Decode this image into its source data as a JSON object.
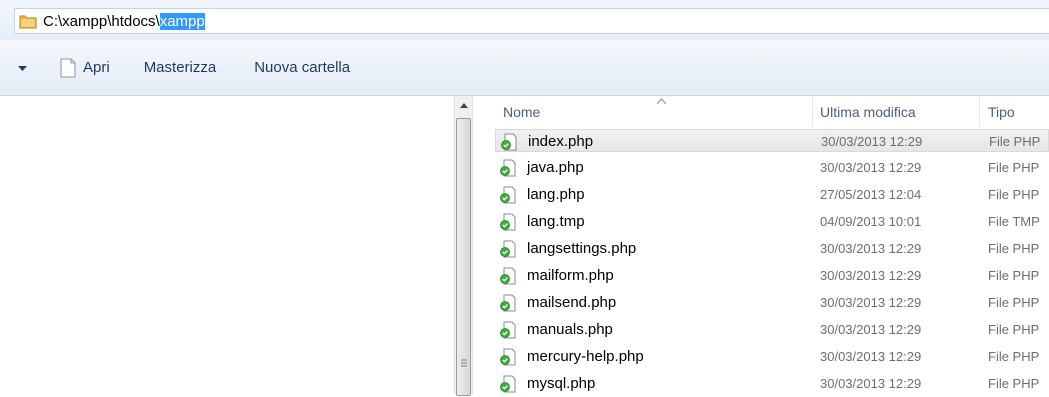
{
  "address": {
    "path_prefix": "C:\\xampp\\htdocs\\",
    "path_selected": "xampp"
  },
  "toolbar": {
    "open_label": "Apri",
    "burn_label": "Masterizza",
    "new_folder_label": "Nuova cartella"
  },
  "columns": {
    "name": "Nome",
    "modified": "Ultima modifica",
    "type": "Tipo"
  },
  "files": [
    {
      "name": "index.php",
      "modified": "30/03/2013 12:29",
      "type": "File PHP"
    },
    {
      "name": "java.php",
      "modified": "30/03/2013 12:29",
      "type": "File PHP"
    },
    {
      "name": "lang.php",
      "modified": "27/05/2013 12:04",
      "type": "File PHP"
    },
    {
      "name": "lang.tmp",
      "modified": "04/09/2013 10:01",
      "type": "File TMP"
    },
    {
      "name": "langsettings.php",
      "modified": "30/03/2013 12:29",
      "type": "File PHP"
    },
    {
      "name": "mailform.php",
      "modified": "30/03/2013 12:29",
      "type": "File PHP"
    },
    {
      "name": "mailsend.php",
      "modified": "30/03/2013 12:29",
      "type": "File PHP"
    },
    {
      "name": "manuals.php",
      "modified": "30/03/2013 12:29",
      "type": "File PHP"
    },
    {
      "name": "mercury-help.php",
      "modified": "30/03/2013 12:29",
      "type": "File PHP"
    },
    {
      "name": "mysql.php",
      "modified": "30/03/2013 12:29",
      "type": "File PHP"
    }
  ],
  "selected_row": 0,
  "colors": {
    "selection": "#3399ff",
    "toolbar_text": "#1e395b",
    "php_icon_green": "#3cae3c"
  },
  "icons": {
    "address": "folder-icon",
    "open": "document-icon",
    "file": "php-file-icon"
  }
}
